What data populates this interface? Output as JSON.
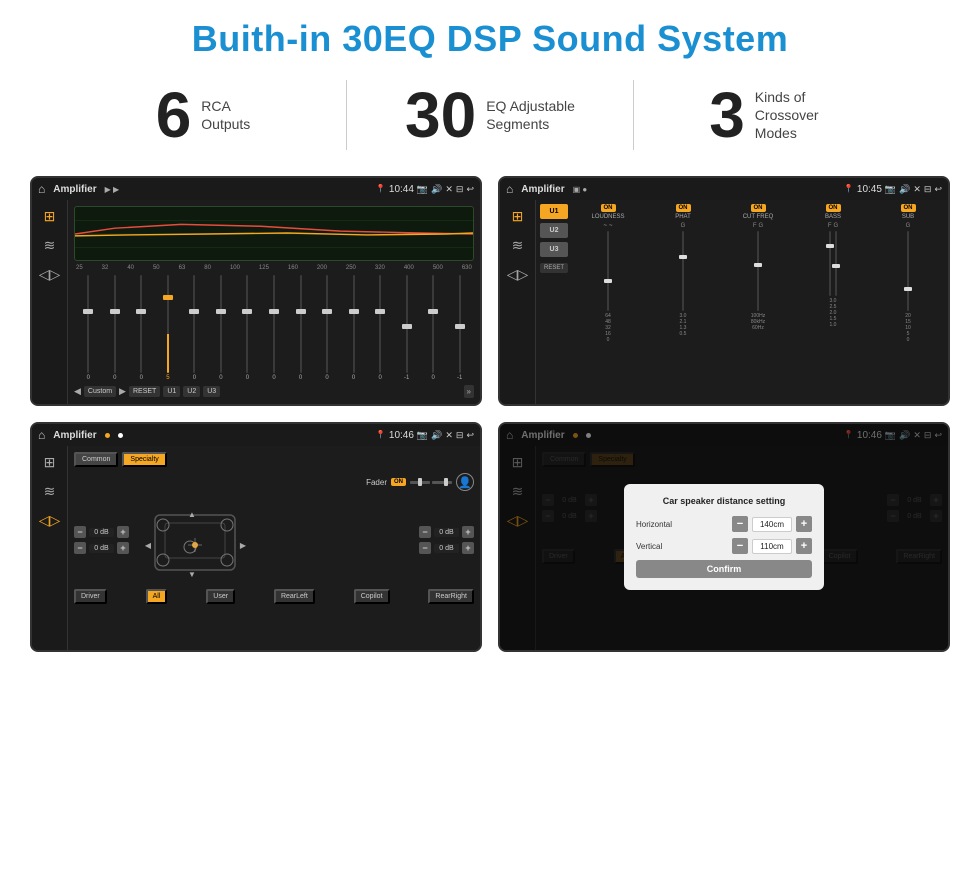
{
  "page": {
    "title": "Buith-in 30EQ DSP Sound System"
  },
  "stats": [
    {
      "number": "6",
      "label": "RCA\nOutputs"
    },
    {
      "number": "30",
      "label": "EQ Adjustable\nSegments"
    },
    {
      "number": "3",
      "label": "Kinds of\nCrossover Modes"
    }
  ],
  "screens": [
    {
      "id": "eq-screen",
      "topbar": {
        "title": "Amplifier",
        "time": "10:44"
      },
      "type": "eq"
    },
    {
      "id": "crossover-screen",
      "topbar": {
        "title": "Amplifier",
        "time": "10:45"
      },
      "type": "crossover"
    },
    {
      "id": "fader-screen",
      "topbar": {
        "title": "Amplifier",
        "time": "10:46"
      },
      "type": "fader"
    },
    {
      "id": "dialog-screen",
      "topbar": {
        "title": "Amplifier",
        "time": "10:46"
      },
      "type": "dialog",
      "dialog": {
        "title": "Car speaker distance setting",
        "horizontal_label": "Horizontal",
        "horizontal_value": "140cm",
        "vertical_label": "Vertical",
        "vertical_value": "110cm",
        "confirm_label": "Confirm"
      }
    }
  ],
  "eq": {
    "frequencies": [
      "25",
      "32",
      "40",
      "50",
      "63",
      "80",
      "100",
      "125",
      "160",
      "200",
      "250",
      "320",
      "400",
      "500",
      "630"
    ],
    "values": [
      "0",
      "0",
      "0",
      "5",
      "0",
      "0",
      "0",
      "0",
      "0",
      "0",
      "0",
      "0",
      "-1",
      "0",
      "-1"
    ],
    "mode": "Custom",
    "buttons": [
      "RESET",
      "U1",
      "U2",
      "U3"
    ]
  },
  "crossover": {
    "presets": [
      "U1",
      "U2",
      "U3"
    ],
    "channels": [
      {
        "label": "LOUDNESS",
        "on": true
      },
      {
        "label": "PHAT",
        "on": true
      },
      {
        "label": "CUT FREQ",
        "on": true
      },
      {
        "label": "BASS",
        "on": true
      },
      {
        "label": "SUB",
        "on": true
      }
    ],
    "reset_label": "RESET"
  },
  "fader": {
    "tabs": [
      "Common",
      "Specialty"
    ],
    "active_tab": "Specialty",
    "fader_label": "Fader",
    "fader_on": "ON",
    "controls": [
      {
        "value": "0 dB"
      },
      {
        "value": "0 dB"
      },
      {
        "value": "0 dB"
      },
      {
        "value": "0 dB"
      }
    ],
    "bottom_buttons": [
      "Driver",
      "All",
      "User",
      "RearLeft",
      "RearRight",
      "Copilot"
    ]
  },
  "dialog": {
    "title": "Car speaker distance setting",
    "horizontal_label": "Horizontal",
    "horizontal_value": "140cm",
    "vertical_label": "Vertical",
    "vertical_value": "110cm",
    "confirm_label": "Confirm",
    "fader_tabs": [
      "Common",
      "Specialty"
    ]
  }
}
